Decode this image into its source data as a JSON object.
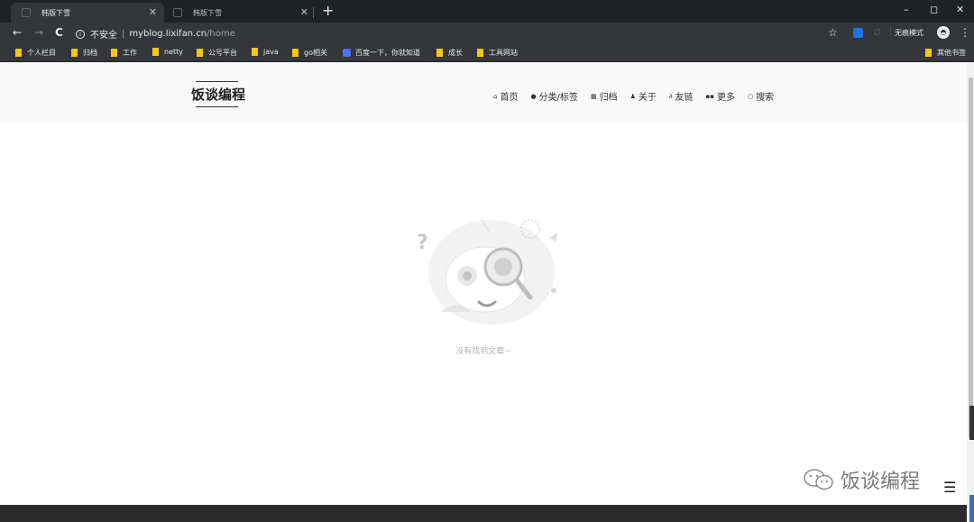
{
  "browser": {
    "tabs": [
      {
        "title": "韩版下雪",
        "active": true
      },
      {
        "title": "韩版下雪",
        "active": false
      }
    ],
    "new_tab_label": "+",
    "window_controls": {
      "minimize": "–",
      "maximize": "◻",
      "close": "✕"
    },
    "nav": {
      "back": "←",
      "forward": "→",
      "reload": "C"
    },
    "address": {
      "security_label": "不安全",
      "host": "myblog.lixifan.cn",
      "path": "/home"
    },
    "incognito_label": "无痕模式",
    "more_icon": "⋮",
    "star_icon": "☆",
    "bookmarks": [
      {
        "label": "个人栏目",
        "icon": "folder"
      },
      {
        "label": "归档",
        "icon": "folder"
      },
      {
        "label": "工作",
        "icon": "folder"
      },
      {
        "label": "netty",
        "icon": "folder"
      },
      {
        "label": "公号平台",
        "icon": "folder"
      },
      {
        "label": "java",
        "icon": "folder"
      },
      {
        "label": "go相关",
        "icon": "folder"
      },
      {
        "label": "百度一下，你就知道",
        "icon": "baidu"
      },
      {
        "label": "成长",
        "icon": "folder"
      },
      {
        "label": "工具网站",
        "icon": "folder"
      }
    ],
    "other_bookmarks": "其他书签"
  },
  "site": {
    "title": "饭谈编程",
    "nav": [
      {
        "icon": "home-icon",
        "glyph": "⌂",
        "label": "首页"
      },
      {
        "icon": "tag-icon",
        "glyph": "●",
        "label": "分类/标签"
      },
      {
        "icon": "archive-icon",
        "glyph": "▦",
        "label": "归档"
      },
      {
        "icon": "user-icon",
        "glyph": "♟",
        "label": "关于"
      },
      {
        "icon": "link-icon",
        "glyph": "∂",
        "label": "友链"
      },
      {
        "icon": "grid-icon",
        "glyph": "▪▪",
        "label": "更多"
      },
      {
        "icon": "search-icon",
        "glyph": "○",
        "label": "搜索"
      }
    ],
    "empty_message": "没有找到文章~"
  },
  "watermark": {
    "text": "饭谈编程",
    "menu_glyph": "☰"
  },
  "colors": {
    "tab_bg": "#202124",
    "toolbar_bg": "#35363a",
    "folder": "#f5c518",
    "header_bg": "#f9f9f9",
    "footer_bg": "#2b2b2b"
  }
}
